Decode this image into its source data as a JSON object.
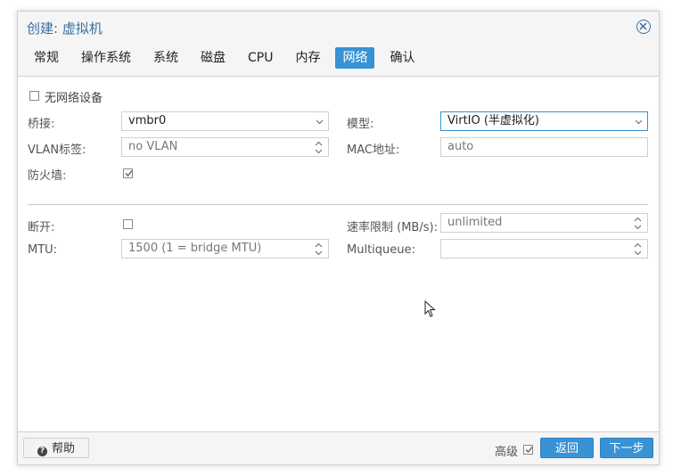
{
  "window": {
    "title": "创建: 虚拟机"
  },
  "tabs": [
    {
      "label": "常规"
    },
    {
      "label": "操作系统"
    },
    {
      "label": "系统"
    },
    {
      "label": "磁盘"
    },
    {
      "label": "CPU"
    },
    {
      "label": "内存"
    },
    {
      "label": "网络"
    },
    {
      "label": "确认"
    }
  ],
  "active_tab": "网络",
  "form": {
    "no_network_label": "无网络设备",
    "bridge_label": "桥接:",
    "bridge_value": "vmbr0",
    "model_label": "模型:",
    "model_value": "VirtIO (半虚拟化)",
    "vlan_label": "VLAN标签:",
    "vlan_value": "no VLAN",
    "mac_label": "MAC地址:",
    "mac_value": "auto",
    "firewall_label": "防火墙:",
    "firewall_checked": true,
    "disconnect_label": "断开:",
    "disconnect_checked": false,
    "rate_label": "速率限制 (MB/s):",
    "rate_value": "unlimited",
    "mtu_label": "MTU:",
    "mtu_value": "1500 (1 = bridge MTU)",
    "multiqueue_label": "Multiqueue:",
    "multiqueue_value": ""
  },
  "footer": {
    "help_label": "帮助",
    "advanced_label": "高级",
    "advanced_checked": true,
    "back_label": "返回",
    "next_label": "下一步"
  },
  "colors": {
    "accent": "#3892d3",
    "title": "#3a6ea5"
  }
}
